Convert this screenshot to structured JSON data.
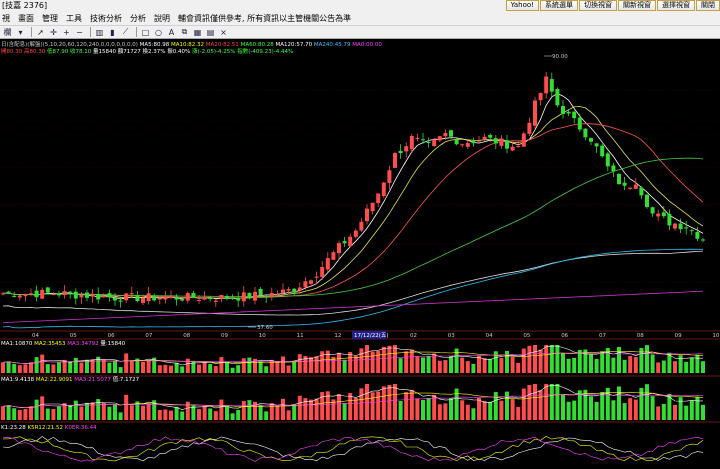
{
  "window": {
    "title": "[技嘉 2376]"
  },
  "top_buttons": [
    "Yahoo!",
    "系統選單",
    "切換視窗",
    "關新視窗",
    "選擇視窗",
    "關閉"
  ],
  "menu": [
    "視",
    "畫面",
    "管理",
    "工具",
    "技術分析",
    "分析",
    "說明",
    "輔會資訊僅供參考, 所有資訊以主管機關公告為準"
  ],
  "toolbar_icons": [
    "dropdown-icon",
    "arrow-icon",
    "crosshair-icon",
    "plus-icon",
    "minus-icon",
    "bar-chart-icon",
    "candle-icon",
    "line-chart-icon",
    "rect-icon",
    "circle-icon",
    "text-icon",
    "copy-icon",
    "grid-icon",
    "table-icon",
    "close-icon"
  ],
  "toolbar_label": "欄",
  "info_row1": [
    {
      "t": "日(含配息)(解盤)(5,10,20,60,120,240,0,0,0,0,0,0,0)",
      "c": "#c8c8c8"
    },
    {
      "t": "MA5:80.98",
      "c": "#ffffff"
    },
    {
      "t": "MA10:82.32",
      "c": "#ffff00"
    },
    {
      "t": "MA20:82.51",
      "c": "#ff4040"
    },
    {
      "t": "MA60:80.28",
      "c": "#40ff40"
    },
    {
      "t": "MA120:57.70",
      "c": "#ffffff"
    },
    {
      "t": "MA240:45.79",
      "c": "#40c0ff"
    },
    {
      "t": "MA0:00.00",
      "c": "#ff40ff"
    }
  ],
  "info_row2": [
    {
      "t": "開80.30",
      "c": "#ff4040"
    },
    {
      "t": "高80.30",
      "c": "#ff4040"
    },
    {
      "t": "低87.90",
      "c": "#40ff40"
    },
    {
      "t": "收78.10",
      "c": "#40ff40"
    },
    {
      "t": "量15840",
      "c": "#ffffff"
    },
    {
      "t": "額71727",
      "c": "#ffffff"
    },
    {
      "t": "換2.37%",
      "c": "#ffffff"
    },
    {
      "t": "振0.40%",
      "c": "#ffffff"
    },
    {
      "t": "漲(-2.05)-4.25%",
      "c": "#40ff40"
    },
    {
      "t": "指數(-409.23)-4.44%",
      "c": "#40ff40"
    }
  ],
  "price_labels": {
    "high": "90.00",
    "low": "37.60"
  },
  "x_labels": [
    "04",
    "05",
    "06",
    "07",
    "08",
    "09",
    "10",
    "11",
    "12",
    "17/12/22",
    "02",
    "03",
    "04",
    "05",
    "06",
    "07",
    "08",
    "09",
    "10"
  ],
  "highlight_label": "17/12/22(五)",
  "vol1_label": [
    {
      "t": "MA1:10870",
      "c": "#ffffff"
    },
    {
      "t": "MA2:35453",
      "c": "#ffff00"
    },
    {
      "t": "MA3:34792",
      "c": "#ff40ff"
    },
    {
      "t": "量:15840",
      "c": "#ffffff"
    }
  ],
  "vol2_label": [
    {
      "t": "MA1:9.4138",
      "c": "#ffffff"
    },
    {
      "t": "MA2:22.9091",
      "c": "#ffff00"
    },
    {
      "t": "MA3:21.5077",
      "c": "#ff40ff"
    },
    {
      "t": "值:7.1727",
      "c": "#ffffff"
    }
  ],
  "ind_label": [
    {
      "t": "K1:23.28",
      "c": "#ffffff"
    },
    {
      "t": "K5R12:21.52",
      "c": "#ffff00"
    },
    {
      "t": "K0ER:36.44",
      "c": "#ff40ff"
    }
  ],
  "colors": {
    "up": "#ff4d4d",
    "down": "#33dd33",
    "bg": "#000000",
    "grid": "#5a0000"
  }
}
